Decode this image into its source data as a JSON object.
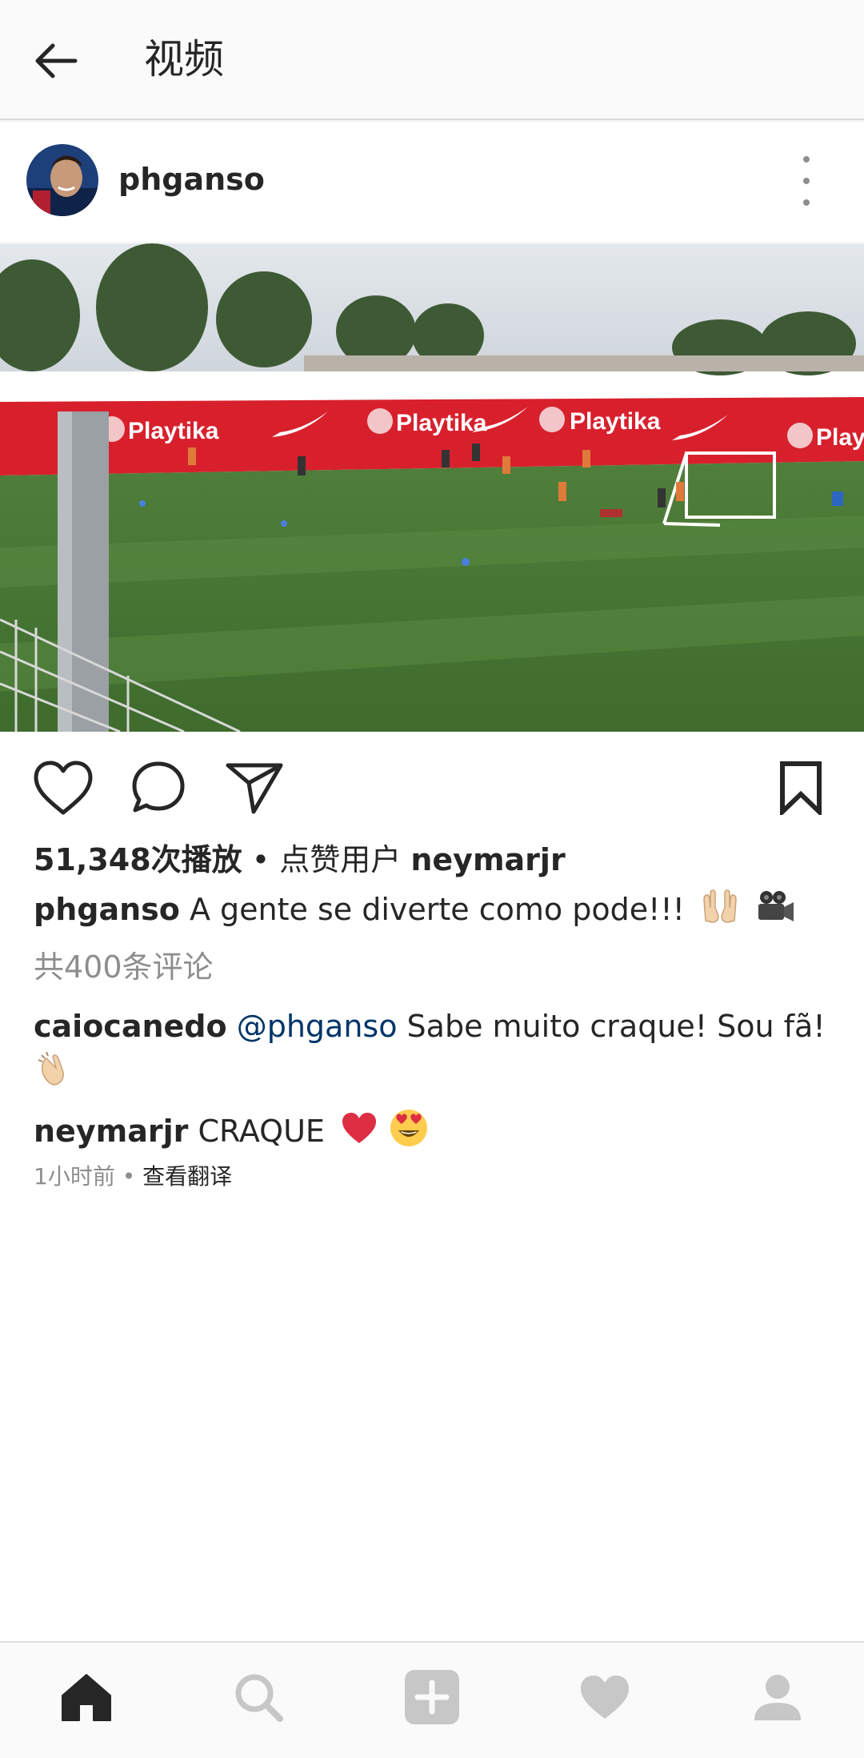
{
  "header": {
    "title": "视频"
  },
  "post": {
    "username": "phganso",
    "views_label": "51,348次播放",
    "liked_by_prefix": "点赞用户",
    "liked_by_user": "neymarjr",
    "caption_user": "phganso",
    "caption_text": "A gente se diverte como pode!!!",
    "view_all_comments": "共400条评论",
    "comments": [
      {
        "user": "caiocanedo",
        "mention": "@phganso",
        "text": "Sabe muito craque! Sou fã!"
      },
      {
        "user": "neymarjr",
        "text": "CRAQUE"
      }
    ],
    "time_ago": "1小时前",
    "see_translation": "查看翻译"
  },
  "video": {
    "banner_sponsor": "Playtika"
  },
  "icons": {
    "back": "arrow-left-icon",
    "more": "more-vertical-icon",
    "like": "heart-outline-icon",
    "comment": "comment-bubble-icon",
    "share": "paper-plane-icon",
    "save": "bookmark-icon",
    "nav": [
      "home-icon",
      "search-icon",
      "add-icon",
      "heart-icon",
      "profile-icon"
    ]
  },
  "colors": {
    "text": "#262626",
    "muted": "#8e8e8e",
    "mention": "#003569",
    "nav_active": "#262626",
    "nav_inactive": "#c7c7c7",
    "banner_red": "#d8202d"
  }
}
